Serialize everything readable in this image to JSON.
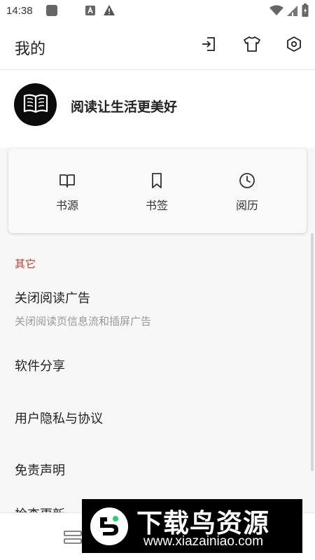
{
  "status_bar": {
    "time": "14:38",
    "icons": [
      "app-notification-icon",
      "a-notification-icon",
      "warning-icon",
      "wifi-icon",
      "signal-icon",
      "battery-icon"
    ]
  },
  "header": {
    "title": "我的",
    "actions": [
      "import-icon",
      "theme-shirt-icon",
      "settings-hexagon-icon"
    ]
  },
  "profile": {
    "avatar_icon": "book-icon",
    "slogan": "阅读让生活更美好"
  },
  "shortcuts": [
    {
      "label": "书源",
      "icon": "book-open-icon"
    },
    {
      "label": "书签",
      "icon": "bookmark-icon"
    },
    {
      "label": "阅历",
      "icon": "clock-icon"
    }
  ],
  "settings": {
    "section_title": "其它",
    "items": [
      {
        "title": "关闭阅读广告",
        "desc": "关闭阅读页信息流和插屏广告"
      },
      {
        "title": "软件分享"
      },
      {
        "title": "用户隐私与协议"
      },
      {
        "title": "免责声明"
      },
      {
        "title": "检查更新"
      }
    ]
  },
  "watermark": {
    "title": "下载鸟资源",
    "url": "www.xiazainiao.com"
  },
  "colors": {
    "accent": "#c0392b",
    "background": "#f7f7f7",
    "surface": "#ffffff"
  }
}
